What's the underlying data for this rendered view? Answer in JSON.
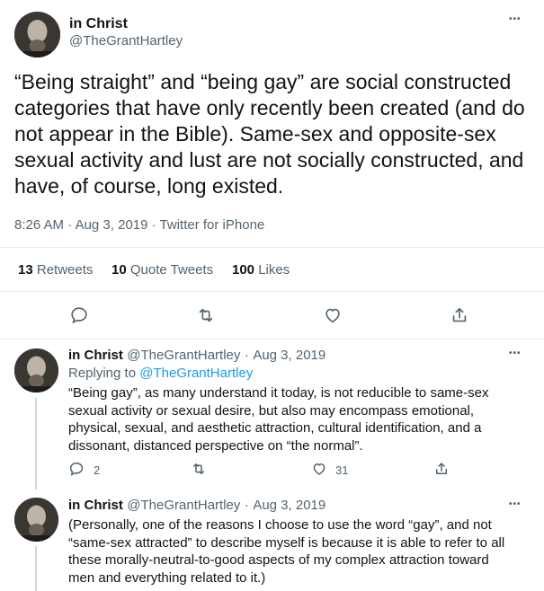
{
  "main_tweet": {
    "name": "in Christ",
    "handle": "@TheGrantHartley",
    "text": "“Being straight” and “being gay” are social constructed categories that have only recently been created (and do not appear in the Bible).  Same-sex and opposite-sex sexual activity and lust are not socially constructed, and have, of course, long existed.",
    "time": "8:26 AM",
    "date": "Aug 3, 2019",
    "source": "Twitter for iPhone",
    "sep": "·",
    "more": "•••",
    "stats": {
      "retweets_count": "13",
      "retweets_label": "Retweets",
      "quotes_count": "10",
      "quotes_label": "Quote Tweets",
      "likes_count": "100",
      "likes_label": "Likes"
    }
  },
  "replies": [
    {
      "name": "in Christ",
      "handle": "@TheGrantHartley",
      "sep": "·",
      "date": "Aug 3, 2019",
      "replying_prefix": "Replying to",
      "replying_handle": "@TheGrantHartley",
      "text": "“Being gay”, as many understand it today, is not reducible to same-sex sexual activity or sexual desire, but also may encompass emotional, physical, sexual, and aesthetic attraction, cultural identification, and a dissonant, distanced perspective on “the normal”.",
      "reply_count": "2",
      "like_count": "31",
      "more": "•••"
    },
    {
      "name": "in Christ",
      "handle": "@TheGrantHartley",
      "sep": "·",
      "date": "Aug 3, 2019",
      "text": "(Personally, one of the reasons I choose to use the word “gay”, and not “same-sex attracted” to describe myself is because it is able to refer to all these morally-neutral-to-good aspects of my complex attraction toward men and everything related to it.)",
      "more": "•••"
    }
  ],
  "icons": [
    "reply-icon",
    "retweet-icon",
    "like-icon",
    "share-icon",
    "more-icon",
    "avatar"
  ],
  "colors": {
    "accent": "#1d9bf0",
    "secondary_text": "#536471",
    "divider": "#e6ecf0"
  }
}
